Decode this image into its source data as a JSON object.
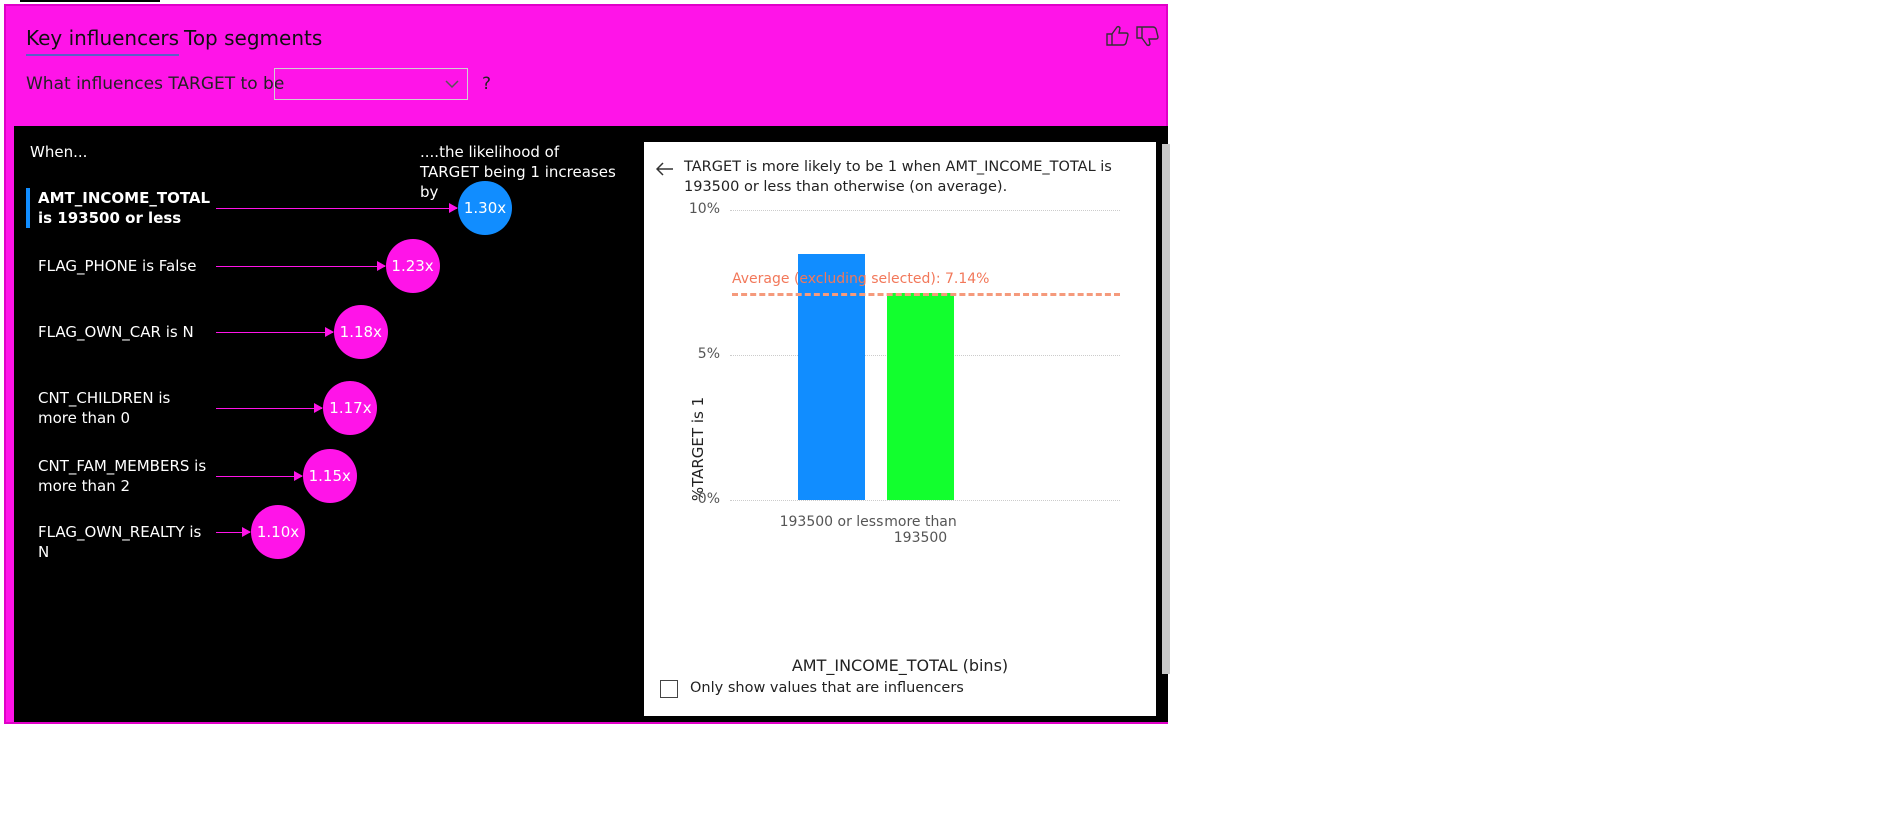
{
  "tabs": {
    "key_influencers": "Key influencers",
    "top_segments": "Top segments"
  },
  "icons": {
    "thumb_up": "thumbs-up-icon",
    "thumb_down": "thumbs-down-icon",
    "back": "back-arrow-icon",
    "dropdown": "chevron-down-icon"
  },
  "question": {
    "prefix": "What influences TARGET to be",
    "selected_value": "",
    "suffix": "?"
  },
  "influencers": {
    "header_left": "When...",
    "header_right": "....the likelihood of TARGET being 1 increases by",
    "items": [
      {
        "label": "AMT_INCOME_TOTAL is 193500 or less",
        "value": "1.30x",
        "selected": true
      },
      {
        "label": "FLAG_PHONE is False",
        "value": "1.23x",
        "selected": false
      },
      {
        "label": "FLAG_OWN_CAR is N",
        "value": "1.18x",
        "selected": false
      },
      {
        "label": "CNT_CHILDREN is more than 0",
        "value": "1.17x",
        "selected": false
      },
      {
        "label": "CNT_FAM_MEMBERS is more than 2",
        "value": "1.15x",
        "selected": false
      },
      {
        "label": "FLAG_OWN_REALTY is N",
        "value": "1.10x",
        "selected": false
      }
    ]
  },
  "detail": {
    "explanation": "TARGET is more likely to be 1 when AMT_INCOME_TOTAL is 193500 or less than otherwise (on average).",
    "checkbox_label": "Only show values that are influencers"
  },
  "chart_data": {
    "type": "bar",
    "categories": [
      "193500 or less",
      "more than 193500"
    ],
    "values": [
      8.5,
      7.14
    ],
    "colors": [
      "#118dff",
      "#12ff2e"
    ],
    "xlabel": "AMT_INCOME_TOTAL (bins)",
    "ylabel": "%TARGET is 1",
    "ylim": [
      0,
      10
    ],
    "yticks": [
      "0%",
      "5%",
      "10%"
    ],
    "grid": true,
    "reference_line": {
      "label": "Average (excluding selected): 7.14%",
      "value": 7.14,
      "color": "#f59a7c"
    }
  },
  "colors": {
    "background": "#ff14e8",
    "panel": "#000000",
    "selected_bubble": "#118dff",
    "bubble": "#ff14e8"
  }
}
